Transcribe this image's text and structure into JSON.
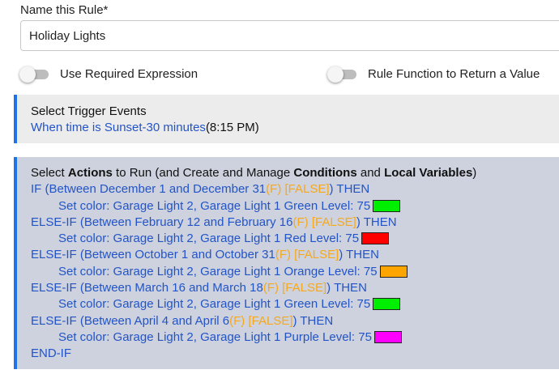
{
  "name_label": "Name this Rule*",
  "rule_name": "Holiday Lights",
  "toggles": [
    {
      "label": "Use Required Expression"
    },
    {
      "label": "Rule Function to Return a Value"
    }
  ],
  "trigger": {
    "heading": "Select Trigger Events",
    "event": "When time is Sunset-30 minutes",
    "time": "(8:15 PM)"
  },
  "actions": {
    "heading_pre": "Select ",
    "heading_b1": "Actions",
    "heading_mid1": " to Run (and Create and Manage ",
    "heading_b2": "Conditions",
    "heading_mid2": " and ",
    "heading_b3": "Local Variables",
    "heading_post": ")",
    "blocks": [
      {
        "cond_kw": "IF (Between December 1 and December 31",
        "flag1": "(F)",
        "flag2": " [FALSE]",
        "then": ") THEN",
        "set": "Set color: Garage Light 2, Garage Light 1  Green  Level: 75",
        "color": "#00ee00"
      },
      {
        "cond_kw": "ELSE-IF (Between February 12 and February 16",
        "flag1": "(F)",
        "flag2": " [FALSE]",
        "then": ") THEN",
        "set": "Set color: Garage Light 2, Garage Light 1  Red  Level: 75",
        "color": "#ff0000"
      },
      {
        "cond_kw": "ELSE-IF (Between October 1 and October 31",
        "flag1": "(F)",
        "flag2": " [FALSE]",
        "then": ") THEN",
        "set": "Set color: Garage Light 2, Garage Light 1  Orange  Level: 75",
        "color": "#ffa500"
      },
      {
        "cond_kw": "ELSE-IF (Between March 16 and March 18",
        "flag1": "(F)",
        "flag2": " [FALSE]",
        "then": ") THEN",
        "set": "Set color: Garage Light 2, Garage Light 1  Green  Level: 75",
        "color": "#00ee00"
      },
      {
        "cond_kw": "ELSE-IF (Between April 4 and April 6",
        "flag1": "(F)",
        "flag2": " [FALSE]",
        "then": ") THEN",
        "set": "Set color: Garage Light 2, Garage Light 1  Purple  Level: 75",
        "color": "#ff00ff"
      }
    ],
    "end": "END-IF"
  }
}
